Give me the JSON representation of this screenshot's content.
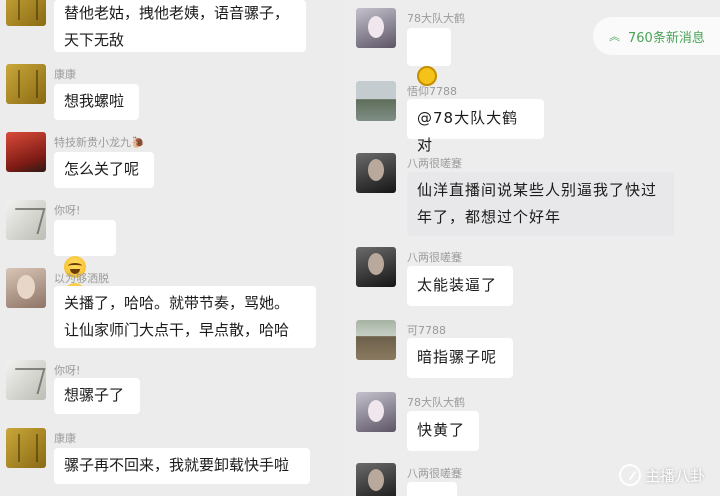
{
  "left_chat": [
    {
      "name": "",
      "text": "替他老姑，拽他老姨，语音骡子，\n天下无敌",
      "avatar": "book-avatar"
    },
    {
      "name": "康康",
      "text": "想我螺啦",
      "avatar": "book-avatar"
    },
    {
      "name": "特技新贵小龙九🐌",
      "text": "怎么关了呢",
      "avatar": "red-figure-avatar"
    },
    {
      "name": "你呀!",
      "text": "",
      "emoji": "laugh-cry-emoji x2",
      "avatar": "sketch-avatar"
    },
    {
      "name": "以为够洒脱",
      "text": "关播了，哈哈。就带节奏，骂她。\n让仙家师门大点干，早点散，哈哈",
      "avatar": "face-avatar"
    },
    {
      "name": "你呀!",
      "text": "想骡子了",
      "avatar": "sketch-avatar"
    },
    {
      "name": "康康",
      "text": "骡子再不回来，我就要卸载快手啦",
      "avatar": "book-avatar"
    }
  ],
  "right_chat": [
    {
      "name": "78大队大鹤",
      "text": "",
      "emoji": "sticker-emoji",
      "avatar": "purple-avatar"
    },
    {
      "name": "悟仰7788",
      "text": "@78大队大鹤 对",
      "avatar": "lake-avatar"
    },
    {
      "name": "八两很嗟蹇",
      "text": "仙洋直播间说某些人别逼我了快过\n年了，都想过个好年",
      "avatar": "dark-avatar"
    },
    {
      "name": "八两很嗟蹇",
      "text": "太能装逼了",
      "avatar": "dark-avatar"
    },
    {
      "name": "可7788",
      "text": "暗指骡子呢",
      "avatar": "field-avatar"
    },
    {
      "name": "78大队大鹤",
      "text": "快黄了",
      "avatar": "purple-avatar"
    },
    {
      "name": "八两很嗟蹇",
      "text": "",
      "avatar": "dark-avatar"
    }
  ],
  "new_messages": {
    "label": "760条新消息",
    "icon": "double-chevron-up-icon"
  },
  "watermark": {
    "text": "主播八卦"
  },
  "colors": {
    "background": "#ececec",
    "bubble": "#ffffff",
    "accent": "#4aa35a"
  }
}
